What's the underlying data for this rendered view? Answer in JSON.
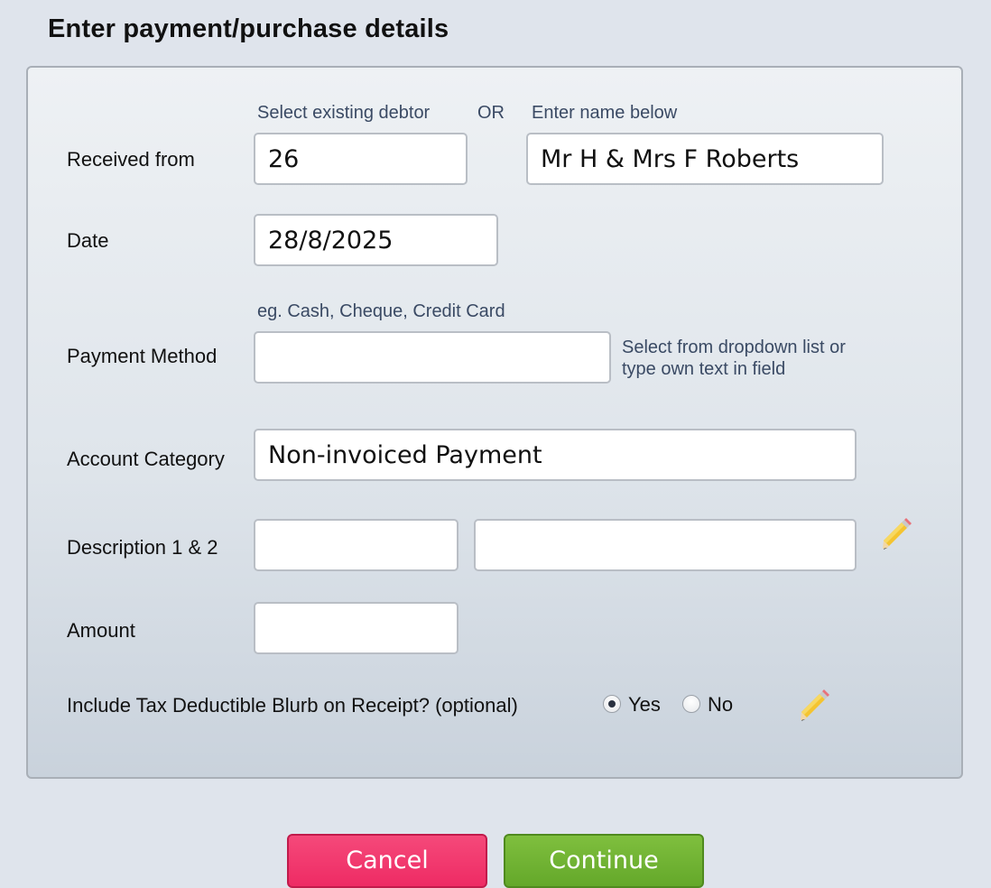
{
  "page": {
    "title": "Enter payment/purchase details"
  },
  "form": {
    "hint_select_debtor": "Select existing debtor",
    "hint_or": "OR",
    "hint_enter_name": "Enter name below",
    "received_from_label": "Received from",
    "debtor_id_value": "26",
    "debtor_name_value": "Mr H & Mrs F Roberts",
    "date_label": "Date",
    "date_value": "28/8/2025",
    "payment_method_hint": "eg. Cash, Cheque, Credit Card",
    "payment_method_label": "Payment Method",
    "payment_method_value": "",
    "payment_method_note_line1": "Select from dropdown list or",
    "payment_method_note_line2": "type own text in field",
    "account_category_label": "Account Category",
    "account_category_value": "Non-invoiced Payment",
    "description_label": "Description 1 & 2",
    "description1_value": "",
    "description2_value": "",
    "amount_label": "Amount",
    "amount_value": "",
    "tax_blurb_label": "Include Tax Deductible Blurb on Receipt? (optional)",
    "tax_blurb_yes": "Yes",
    "tax_blurb_no": "No",
    "tax_blurb_selected": "Yes"
  },
  "buttons": {
    "cancel": "Cancel",
    "continue": "Continue"
  },
  "icons": {
    "edit_description": "pencil-icon",
    "edit_tax_blurb": "pencil-icon"
  },
  "colors": {
    "cancel": "#ee2b64",
    "continue": "#6aac2e",
    "hint_text": "#3a4a64"
  }
}
